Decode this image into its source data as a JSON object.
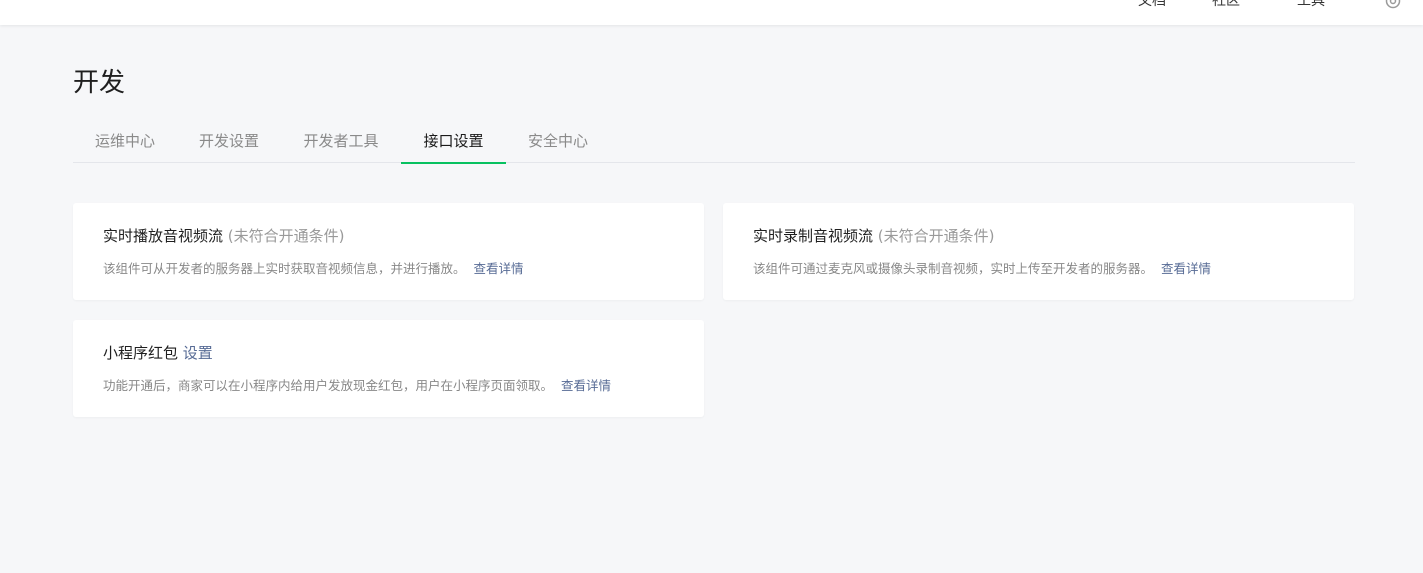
{
  "topbar": {
    "links": [
      "文档",
      "社区",
      "工具"
    ],
    "settings_icon": "gear-icon"
  },
  "page": {
    "title": "开发"
  },
  "tabs": [
    {
      "label": "运维中心",
      "active": false
    },
    {
      "label": "开发设置",
      "active": false
    },
    {
      "label": "开发者工具",
      "active": false
    },
    {
      "label": "接口设置",
      "active": true
    },
    {
      "label": "安全中心",
      "active": false
    }
  ],
  "cards": [
    {
      "title": "实时播放音视频流",
      "note": "(未符合开通条件)",
      "desc": "该组件可从开发者的服务器上实时获取音视频信息，并进行播放。",
      "more": "查看详情"
    },
    {
      "title": "实时录制音视频流",
      "note": "(未符合开通条件)",
      "desc": "该组件可通过麦克风或摄像头录制音视频，实时上传至开发者的服务器。",
      "more": "查看详情"
    },
    {
      "title": "小程序红包",
      "action": "设置",
      "desc": "功能开通后，商家可以在小程序内给用户发放现金红包，用户在小程序页面领取。",
      "more": "查看详情"
    }
  ],
  "colors": {
    "accent_green": "#07c160",
    "link_blue": "#576b95",
    "background": "#f6f7f9"
  }
}
